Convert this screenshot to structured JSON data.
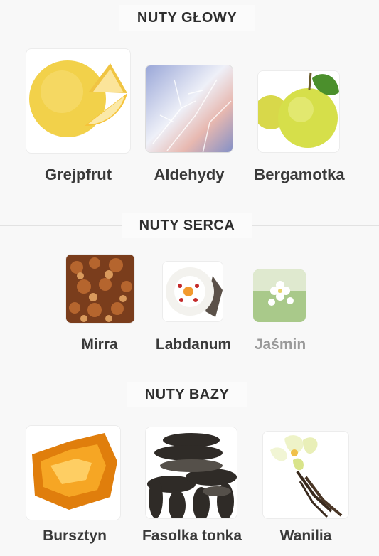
{
  "sections": {
    "top": {
      "title": "NUTY GŁOWY"
    },
    "heart": {
      "title": "NUTY SERCA"
    },
    "base": {
      "title": "NUTY BAZY"
    }
  },
  "top_notes": [
    {
      "name": "Grejpfrut",
      "icon": "grapefruit-image"
    },
    {
      "name": "Aldehydy",
      "icon": "frost-image"
    },
    {
      "name": "Bergamotka",
      "icon": "bergamot-image"
    }
  ],
  "heart_notes": [
    {
      "name": "Mirra",
      "icon": "myrrh-image"
    },
    {
      "name": "Labdanum",
      "icon": "labdanum-flower-image"
    },
    {
      "name": "Jaśmin",
      "icon": "jasmine-image"
    }
  ],
  "base_notes": [
    {
      "name": "Bursztyn",
      "icon": "amber-image"
    },
    {
      "name": "Fasolka tonka",
      "icon": "tonka-bean-image"
    },
    {
      "name": "Wanilia",
      "icon": "vanilla-image"
    }
  ]
}
